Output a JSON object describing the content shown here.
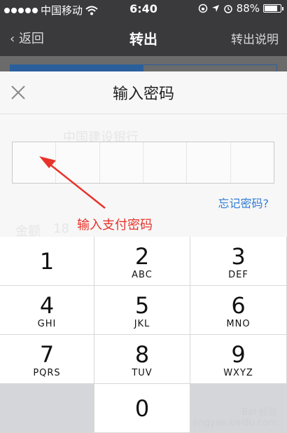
{
  "status_bar": {
    "carrier": "中国移动",
    "time": "6:40",
    "battery": "88%",
    "battery_level": 0.88
  },
  "nav": {
    "back": "返回",
    "title": "转出",
    "help": "转出说明"
  },
  "background": {
    "bank_name": "中国建设银行",
    "amount_label": "金额",
    "amount_value": "18"
  },
  "dialog": {
    "title": "输入密码",
    "forgot": "忘记密码?",
    "annotation": "输入支付密码",
    "digits": 6
  },
  "keypad": [
    {
      "num": "1",
      "letters": ""
    },
    {
      "num": "2",
      "letters": "ABC"
    },
    {
      "num": "3",
      "letters": "DEF"
    },
    {
      "num": "4",
      "letters": "GHI"
    },
    {
      "num": "5",
      "letters": "JKL"
    },
    {
      "num": "6",
      "letters": "MNO"
    },
    {
      "num": "7",
      "letters": "PQRS"
    },
    {
      "num": "8",
      "letters": "TUV"
    },
    {
      "num": "9",
      "letters": "WXYZ"
    },
    {
      "num": "0",
      "letters": ""
    }
  ],
  "watermark": {
    "line1": "Bai 经验",
    "line2": "jingyan.baidu.com"
  },
  "colors": {
    "nav_bg": "#3a3a3c",
    "link": "#2f7bd6",
    "annotation": "#e8332a"
  }
}
